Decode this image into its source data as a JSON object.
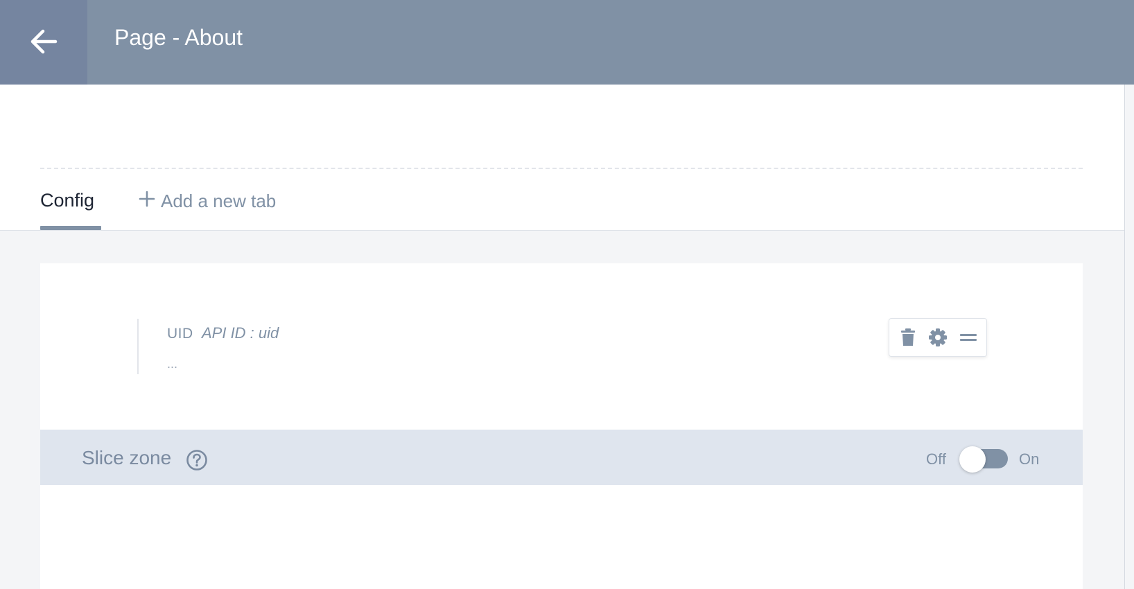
{
  "header": {
    "title": "Page - About",
    "back_icon": "arrow-left-icon"
  },
  "tabs": [
    {
      "label": "Config",
      "active": true
    }
  ],
  "add_tab": {
    "label": "Add a new tab",
    "icon": "plus-icon"
  },
  "field": {
    "type_label": "UID",
    "api_id": "API ID : uid",
    "placeholder": "...",
    "tools": [
      "trash-icon",
      "gear-icon",
      "drag-handle-icon"
    ]
  },
  "slice_zone": {
    "title": "Slice zone",
    "help_icon": "question-circle-icon",
    "toggle_off_label": "Off",
    "toggle_on_label": "On",
    "enabled": false
  },
  "colors": {
    "header_bg": "#8091a5",
    "accent": "#8091a5",
    "slice_bar_bg": "#dfe5ee",
    "page_bg": "#f4f5f7"
  }
}
